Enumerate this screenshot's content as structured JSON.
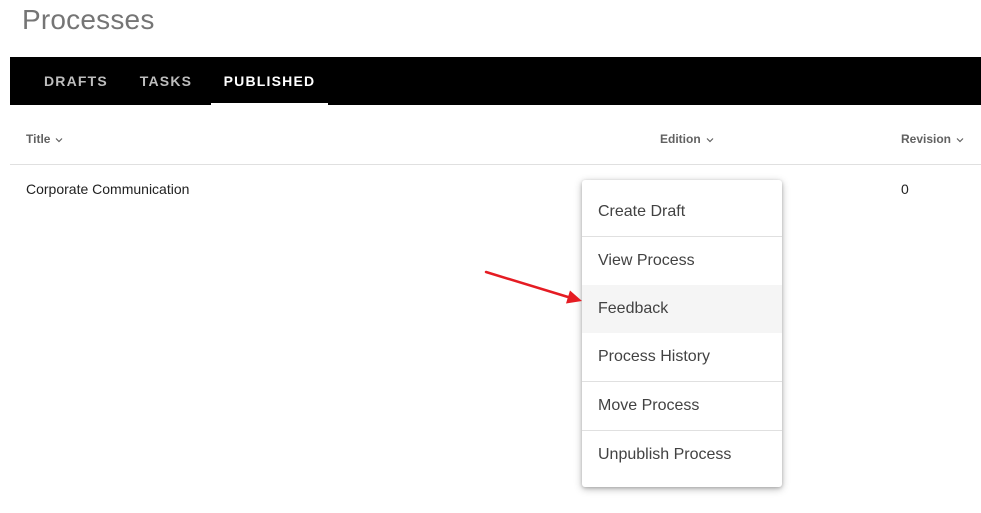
{
  "page": {
    "title": "Processes"
  },
  "tabs": [
    {
      "label": "DRAFTS",
      "active": false
    },
    {
      "label": "TASKS",
      "active": false
    },
    {
      "label": "PUBLISHED",
      "active": true
    }
  ],
  "table": {
    "columns": [
      {
        "label": "Title",
        "icon": "chevron-down-icon"
      },
      {
        "label": "Edition",
        "icon": "chevron-down-icon"
      },
      {
        "label": "Revision",
        "icon": "chevron-down-icon"
      }
    ],
    "rows": [
      {
        "title": "Corporate Communication",
        "edition": "",
        "revision": "0"
      }
    ]
  },
  "context_menu": {
    "items": [
      {
        "label": "Create Draft"
      },
      {
        "label": "View Process"
      },
      {
        "label": "Feedback",
        "highlighted": true
      },
      {
        "label": "Process History"
      },
      {
        "label": "Move Process"
      },
      {
        "label": "Unpublish Process"
      }
    ]
  },
  "annotation": {
    "arrow_color": "#e51c23",
    "points_to": "Feedback"
  },
  "colors": {
    "tabbar_background": "#000000",
    "active_tab_text": "#ffffff",
    "inactive_tab_text": "#bdbdbd",
    "menu_hover": "#f5f5f5"
  }
}
